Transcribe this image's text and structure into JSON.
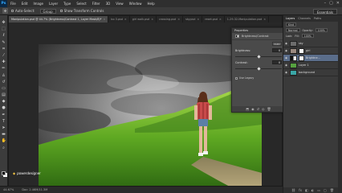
{
  "app": {
    "logo": "Ps",
    "window_controls": [
      "–",
      "▢",
      "✕"
    ]
  },
  "menu": [
    "File",
    "Edit",
    "Image",
    "Layer",
    "Type",
    "Select",
    "Filter",
    "3D",
    "View",
    "Window",
    "Help"
  ],
  "options": {
    "auto_select_label": "Auto-Select:",
    "auto_select_value": "Group",
    "transform_controls_label": "Show Transform Controls",
    "workspace": "Essentials"
  },
  "tabs": [
    {
      "label": "Manipulation.psd @ 44.7% (Brightness/Contrast 1, Layer Mask/8)*",
      "active": true
    },
    {
      "label": "bo 3.psd",
      "active": false
    },
    {
      "label": "girl walk.psd",
      "active": false
    },
    {
      "label": "crossing.psd",
      "active": false
    },
    {
      "label": "sky.psd",
      "active": false
    },
    {
      "label": "reset.psd",
      "active": false
    },
    {
      "label": "1-29-32-Manipulation.psd",
      "active": false
    }
  ],
  "properties": {
    "header": "Properties",
    "adjustment": "Brightness/Contrast",
    "auto_label": "Auto",
    "brightness_label": "Brightness:",
    "brightness_value": "0",
    "brightness_fraction": 0.5,
    "contrast_label": "Contrast:",
    "contrast_value": "0",
    "contrast_fraction": 0.5,
    "legacy_label": "Use Legacy"
  },
  "layers_panel": {
    "tabs": [
      "Layers",
      "Channels",
      "Paths"
    ],
    "kind_label": "Kind",
    "blend_mode": "Normal",
    "opacity_label": "Opacity:",
    "opacity_value": "100%",
    "fill_label": "Fill:",
    "fill_value": "100%",
    "lock_label": "Lock:",
    "layers": [
      {
        "name": "sky",
        "selected": false,
        "thumb_color": "#6c6c6c",
        "mask": false
      },
      {
        "name": "girl",
        "selected": false,
        "thumb_color": "#9a8a80",
        "mask": true
      },
      {
        "name": "Brightne...",
        "selected": true,
        "thumb_color": "#444444",
        "mask": true
      },
      {
        "name": "Layer 1",
        "selected": false,
        "thumb_color": "#56a140",
        "mask": false
      },
      {
        "name": "background",
        "selected": false,
        "thumb_color": "#3aa6a6",
        "mask": false
      }
    ]
  },
  "status": {
    "zoom": "44.67%",
    "doc": "Doc: 2.46M/11.3M"
  },
  "watermark": "powerdesigner",
  "colors": {
    "accent_selected": "#5a6d8a",
    "panel": "#3a3a3a",
    "background": "#282828"
  }
}
